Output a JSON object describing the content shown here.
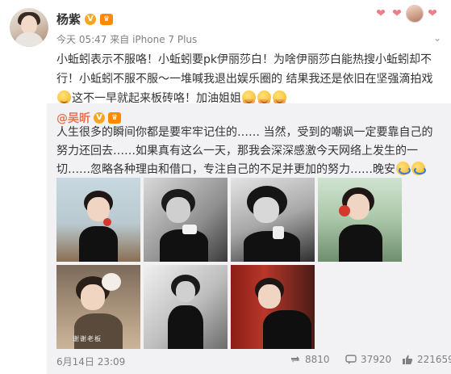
{
  "post": {
    "author": "杨紫",
    "verified_badge": "V",
    "vip_badge": "♛",
    "time": "今天 05:47",
    "source_prefix": "来自",
    "source": "iPhone 7 Plus",
    "text": "小蚯蚓表示不服咯！小蚯蚓要pk伊丽莎白！为啥伊丽莎白能热搜小蚯蚓却不行！小蚯蚓不服不服～一堆喊我退出娱乐圈的 结果我还是依旧在坚强滴拍戏",
    "text_after_emoji": "这不一早就起来板砖咯！加油姐姐",
    "emoji_1": "smirk-face-emoji",
    "emoji_2": "clapping-face-emoji"
  },
  "repost": {
    "author": "@吴昕",
    "verified_badge": "V",
    "vip_badge": "♛",
    "text": "人生很多的瞬间你都是要牢牢记住的…… 当然，受到的嘲讽一定要靠自己的努力还回去……如果真有这么一天，那我会深深感激今天网络上发生的一切……忽略各种理由和借口，专注自己的不足并更加的努力……晚安",
    "emoji": "sleepy-face-emoji",
    "photo_watermark": "谢谢老板",
    "date": "6月14日 23:09",
    "stats": {
      "reposts": "8810",
      "comments": "37920",
      "likes": "221659"
    }
  },
  "icons": [
    "heart-icon",
    "repost-icon",
    "comment-icon",
    "like-icon",
    "chevron-down-icon"
  ],
  "colors": {
    "link": "#eb7350",
    "repost_bg": "#f2f2f5",
    "meta": "#808080",
    "badge": "#f5a623"
  }
}
